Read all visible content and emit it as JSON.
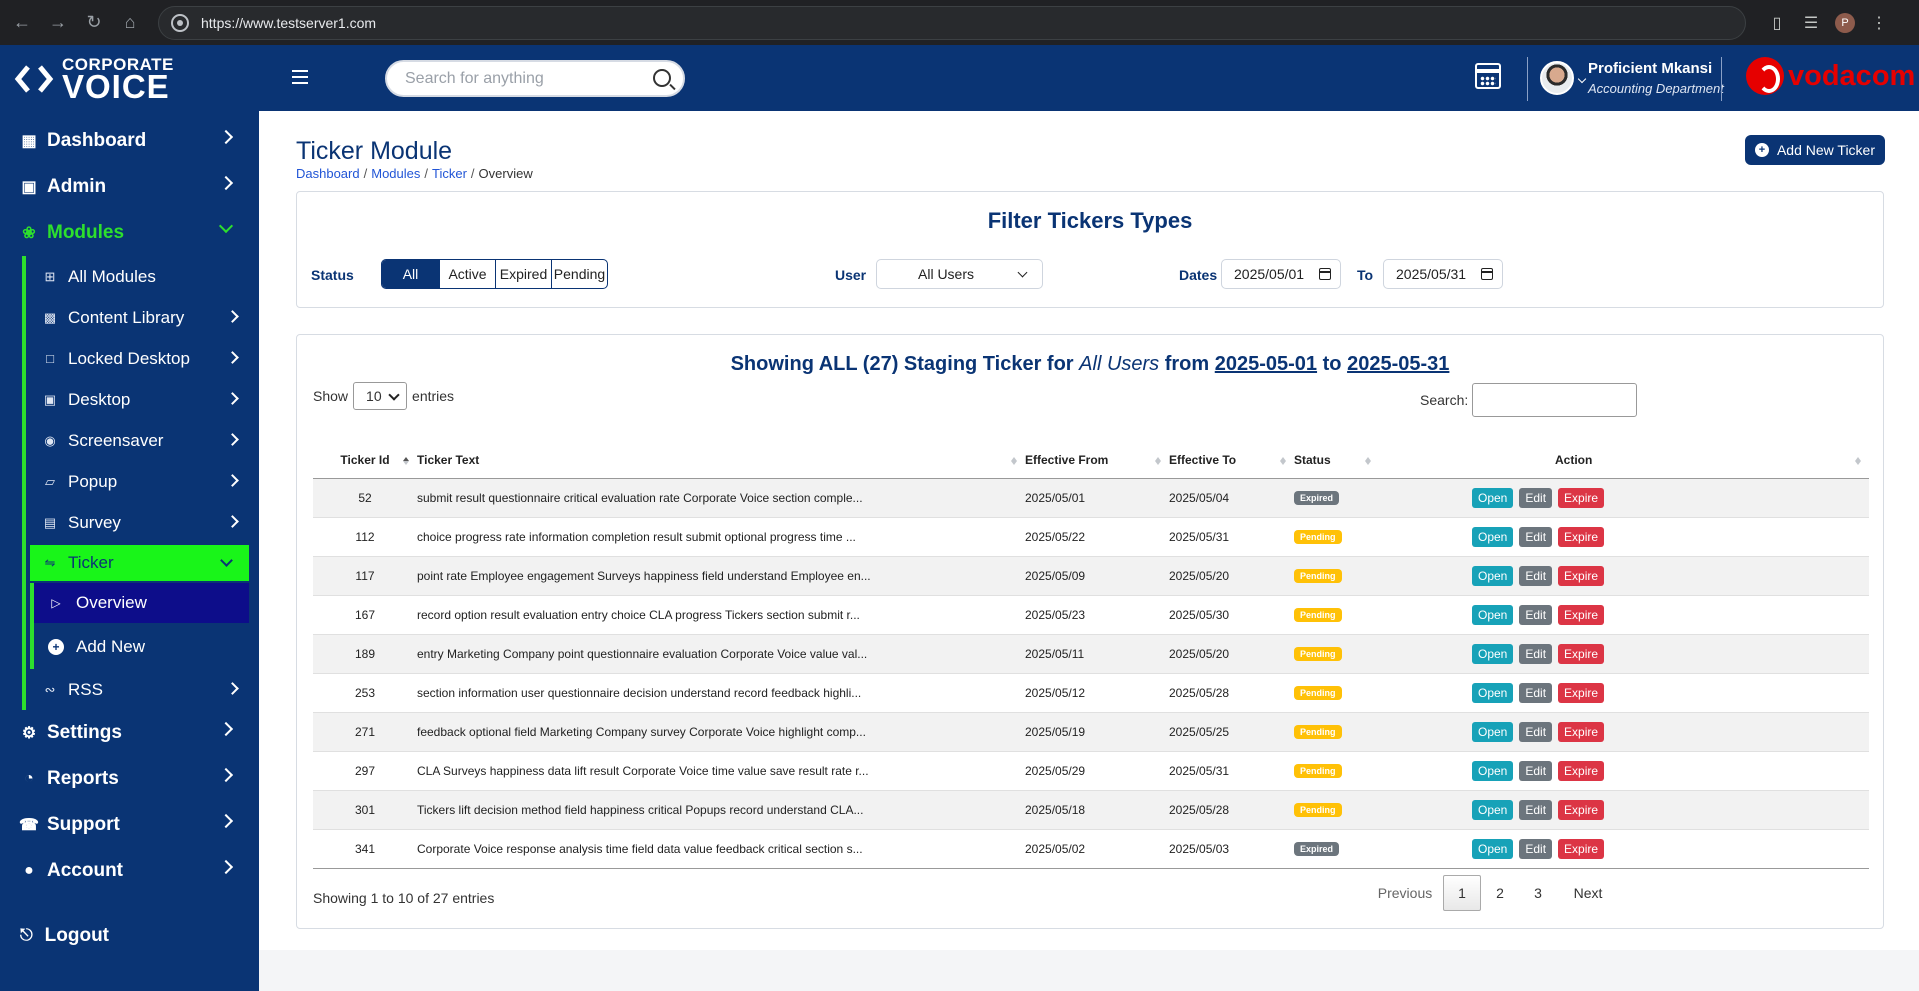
{
  "browser": {
    "url": "https://www.testserver1.com",
    "profile_initial": "P"
  },
  "brand": {
    "line1": "CORPORATE",
    "line2": "VOICE"
  },
  "sidebar": {
    "items": [
      {
        "label": "Dashboard",
        "icon": "dashboard-icon"
      },
      {
        "label": "Admin",
        "icon": "admin-icon"
      },
      {
        "label": "Modules",
        "icon": "modules-icon"
      }
    ],
    "modules_sub": [
      {
        "label": "All Modules",
        "icon": "grid-icon"
      },
      {
        "label": "Content Library",
        "icon": "images-icon"
      },
      {
        "label": "Locked Desktop",
        "icon": "lock-icon"
      },
      {
        "label": "Desktop",
        "icon": "monitor-icon"
      },
      {
        "label": "Screensaver",
        "icon": "screensaver-icon"
      },
      {
        "label": "Popup",
        "icon": "popup-icon"
      },
      {
        "label": "Survey",
        "icon": "clipboard-icon"
      },
      {
        "label": "Ticker",
        "icon": "ticker-icon"
      }
    ],
    "ticker_sub": [
      {
        "label": "Overview",
        "icon": "overview-icon"
      },
      {
        "label": "Add New",
        "icon": "plus-circle-icon"
      }
    ],
    "rss": {
      "label": "RSS",
      "icon": "rss-icon"
    },
    "bottom": [
      {
        "label": "Settings",
        "icon": "gear-icon"
      },
      {
        "label": "Reports",
        "icon": "chart-pie-icon"
      },
      {
        "label": "Support",
        "icon": "support-icon"
      },
      {
        "label": "Account",
        "icon": "user-icon"
      }
    ],
    "logout": "Logout"
  },
  "topbar": {
    "search_placeholder": "Search for anything",
    "user_name": "Proficient Mkansi",
    "user_dept": "Accounting Department",
    "partner": "vodacom"
  },
  "page": {
    "title": "Ticker Module",
    "breadcrumb": [
      "Dashboard",
      "Modules",
      "Ticker",
      "Overview"
    ],
    "add_button": "Add New Ticker"
  },
  "filter": {
    "title": "Filter Tickers Types",
    "status_label": "Status",
    "status_options": [
      "All",
      "Active",
      "Expired",
      "Pending"
    ],
    "user_label": "User",
    "user_value": "All Users",
    "dates_label": "Dates",
    "date_from": "2025/05/01",
    "to_label": "To",
    "date_to": "2025/05/31"
  },
  "table": {
    "heading_pre": "Showing ALL (27) Staging Ticker for",
    "heading_user": "All Users",
    "heading_from_word": "from",
    "heading_from": "2025-05-01",
    "heading_to_word": "to",
    "heading_to": "2025-05-31",
    "show_label": "Show",
    "entries_value": "10",
    "entries_label": "entries",
    "search_label": "Search:",
    "columns": [
      "Ticker Id",
      "Ticker Text",
      "Effective From",
      "Effective To",
      "Status",
      "Action"
    ],
    "rows": [
      {
        "id": "52",
        "text": "submit result questionnaire critical evaluation rate Corporate Voice section comple...",
        "from": "2025/05/01",
        "to": "2025/05/04",
        "status": "Expired"
      },
      {
        "id": "112",
        "text": "choice progress rate information completion result submit optional progress time ...",
        "from": "2025/05/22",
        "to": "2025/05/31",
        "status": "Pending"
      },
      {
        "id": "117",
        "text": "point rate Employee engagement Surveys happiness field understand Employee en...",
        "from": "2025/05/09",
        "to": "2025/05/20",
        "status": "Pending"
      },
      {
        "id": "167",
        "text": "record option result evaluation entry choice CLA progress Tickers section submit r...",
        "from": "2025/05/23",
        "to": "2025/05/30",
        "status": "Pending"
      },
      {
        "id": "189",
        "text": "entry Marketing Company point questionnaire evaluation Corporate Voice value val...",
        "from": "2025/05/11",
        "to": "2025/05/20",
        "status": "Pending"
      },
      {
        "id": "253",
        "text": "section information user questionnaire decision understand record feedback highli...",
        "from": "2025/05/12",
        "to": "2025/05/28",
        "status": "Pending"
      },
      {
        "id": "271",
        "text": "feedback optional field Marketing Company survey Corporate Voice highlight comp...",
        "from": "2025/05/19",
        "to": "2025/05/25",
        "status": "Pending"
      },
      {
        "id": "297",
        "text": "CLA Surveys happiness data lift result Corporate Voice time value save result rate r...",
        "from": "2025/05/29",
        "to": "2025/05/31",
        "status": "Pending"
      },
      {
        "id": "301",
        "text": "Tickers lift decision method field happiness critical Popups record understand CLA...",
        "from": "2025/05/18",
        "to": "2025/05/28",
        "status": "Pending"
      },
      {
        "id": "341",
        "text": "Corporate Voice response analysis time field data value feedback critical section s...",
        "from": "2025/05/02",
        "to": "2025/05/03",
        "status": "Expired"
      }
    ],
    "actions": [
      "Open",
      "Edit",
      "Expire"
    ],
    "info": "Showing 1 to 10 of 27 entries",
    "pagination": {
      "previous": "Previous",
      "pages": [
        "1",
        "2",
        "3"
      ],
      "next": "Next"
    }
  },
  "colors": {
    "navy": "#0a3474",
    "green": "#19f519",
    "open": "#17a2b8",
    "edit": "#6c757d",
    "expire": "#dc3545",
    "pending": "#ffc107"
  }
}
